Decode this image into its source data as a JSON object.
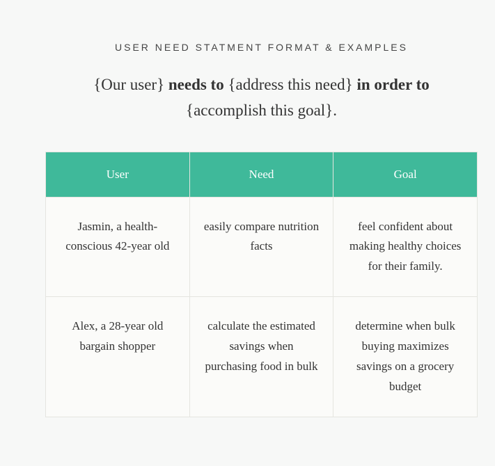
{
  "title": "USER NEED STATMENT FORMAT & EXAMPLES",
  "format": {
    "part1": "{Our user} ",
    "bold1": "needs to",
    "part2": " {address this need} ",
    "bold2": "in order to",
    "part3": " {accomplish this goal}."
  },
  "headers": {
    "user": "User",
    "need": "Need",
    "goal": "Goal"
  },
  "rows": [
    {
      "user": "Jasmin, a health-conscious 42-year old",
      "need": "easily compare nutrition facts",
      "goal": "feel confident about making healthy choices for their family."
    },
    {
      "user": "Alex, a 28-year old bargain shopper",
      "need": "calculate the estimated savings when purchasing food in bulk",
      "goal": "determine when bulk buying maximizes savings on a grocery budget"
    }
  ]
}
